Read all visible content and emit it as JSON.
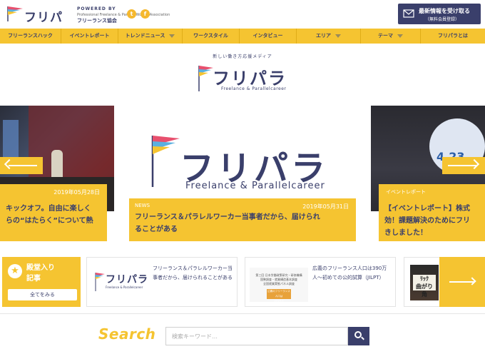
{
  "header": {
    "logo_text": "フリパラ",
    "powered_by": "POWERED BY",
    "powered_org_en": "Professional Freelance & Parallel Worker Association",
    "powered_org": "フリーランス協会",
    "twitter_icon": "twitter-icon",
    "facebook_icon": "facebook-icon",
    "subscribe_line1": "最新情報を受け取る",
    "subscribe_line2": "（無料会員登録）"
  },
  "nav": {
    "items": [
      {
        "label": "フリーランスハック"
      },
      {
        "label": "イベントレポート"
      },
      {
        "label": "トレンドニュース"
      },
      {
        "label": "ワークスタイル"
      },
      {
        "label": "インタビュー"
      },
      {
        "label": "エリア"
      },
      {
        "label": "テーマ"
      },
      {
        "label": "フリパラとは"
      }
    ]
  },
  "brand": {
    "tagline": "新しい働き方応援メディア",
    "logo_text": "フリパラ",
    "logo_sub": "Freelance & Parallelcareer"
  },
  "slider": {
    "left": {
      "date": "2019年05月28日",
      "title": "キックオフ。自由に楽しく\nらの“はたらく”について熱"
    },
    "center": {
      "logo_text": "フリパラ",
      "logo_sub": "Freelance & Parallelcareer",
      "category": "NEWS",
      "date": "2019年05月31日",
      "title": "フリーランス＆パラレルワーカー当事者だから、届けられ\nることがある"
    },
    "right": {
      "category": "イベントレポート",
      "poster_date": "4.23",
      "title": "【イベントレポート】株式\n効！課題解決のためにフリ\nきしました！"
    }
  },
  "featured": {
    "hall_title": "殿堂入り\n記事",
    "see_all": "全てをみる",
    "cards": [
      {
        "thumb_text": "フリパラ",
        "thumb_sub": "Freelance & Parallelcareer",
        "text": "フリーランス＆パラレルワーカー当事者だから、届けられることがある"
      },
      {
        "doc_lines": "第三回 日本労働政策研究・研修機構\n国勢調査・就業構造基本調査\n全国就業実態パネル調査",
        "doc_badge": "広義のフリーランス人口は\n390万人",
        "text": "広義のフリーランス人口は390万人〜初めての公的試算（JILPT）"
      },
      {
        "sign_text": "ﾘｯｸ\n曲がり\n角"
      }
    ]
  },
  "search": {
    "title": "Search",
    "placeholder": "検索キーワード…"
  },
  "colors": {
    "accent": "#f5c431",
    "brand_navy": "#3a3f6b"
  }
}
